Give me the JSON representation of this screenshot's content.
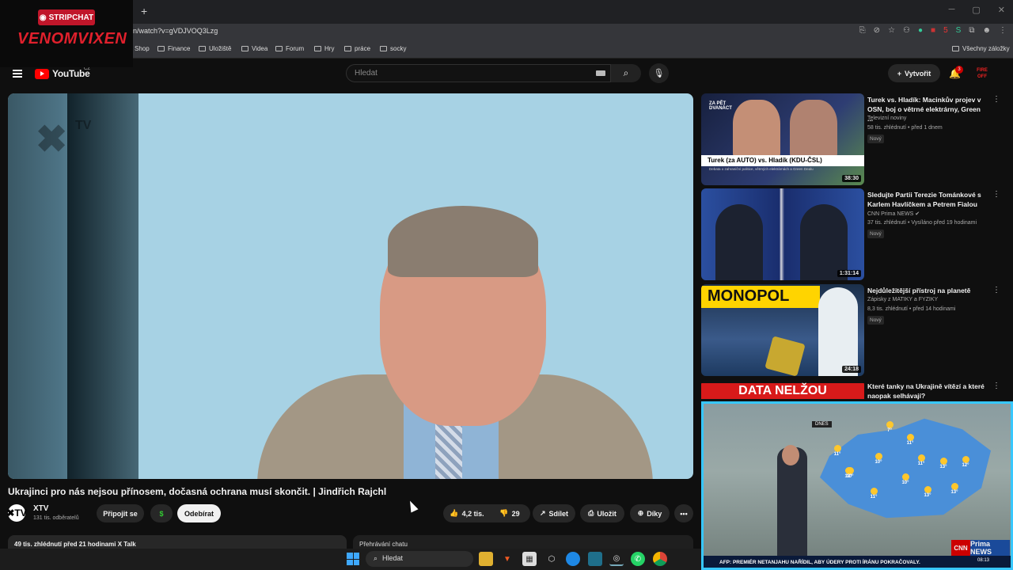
{
  "overlay": {
    "badge": "STRIPCHAT",
    "name": "VENOMVIXEN"
  },
  "browser": {
    "new_tab": "+",
    "url": "n/watch?v=gVDJVOQ3Lzg",
    "bookmarks": [
      "Shop",
      "Finance",
      "Uložiště",
      "Videa",
      "Forum",
      "Hry",
      "práce",
      "socky"
    ],
    "all_bookmarks": "Všechny záložky",
    "ext_badge": "5"
  },
  "youtube": {
    "logo": "YouTube",
    "region": "CZ",
    "search_placeholder": "Hledat",
    "create_label": "Vytvořit",
    "notif_count": "3",
    "avatar_text": "FIRE OFF"
  },
  "video": {
    "title": "Ukrajinci pro nás nejsou přínosem, dočasná ochrana musí skončit. | Jindřich Rajchl",
    "channel_logo": "✖TV",
    "watermark": "TV",
    "channel": "XTV",
    "subs": "131 tis. odběratelů",
    "join_label": "Připojit se",
    "dollar": "$",
    "subscribe_label": "Odebírat",
    "likes": "4,2 tis.",
    "dislikes": "29",
    "share_label": "Sdílet",
    "save_label": "Uložit",
    "thanks_label": "Díky",
    "more": "•••",
    "desc_line": "49 tis. zhlédnutí  před 21 hodinami  X Talk",
    "chat_replay": "Přehrávání chatu"
  },
  "recommendations": [
    {
      "title": "Turek vs. Hladík: Macinkův projev v OSN, boj o větrné elektrárny, Green ...",
      "channel": "Televizní noviny",
      "meta": "58 tis. zhlédnutí • před 1 dnem",
      "badge": "Nový",
      "duration": "38:30",
      "thumb_text": "Turek (za AUTO) vs. Hladík (KDU-ČSL)",
      "thumb_sub": "Debata o zahraniční politice, větrných elektrárnách a Green Dealu",
      "thumb_tag": "ZA PĚT\nDVANÁCT"
    },
    {
      "title": "Sledujte Partii Terezie Tománkové s Karlem Havlíčkem a Petrem Fialou",
      "channel": "CNN Prima NEWS ✔",
      "meta": "37 tis. zhlédnutí • Vysíláno před 19 hodinami",
      "badge": "Nový",
      "duration": "1:31:14"
    },
    {
      "title": "Nejdůležitější přístroj na planetě",
      "channel": "Zápisky z MATIKY a FYZIKY",
      "meta": "8,3 tis. zhlédnutí • před 14 hodinami",
      "badge": "Nový",
      "duration": "24:18",
      "thumb_text": "MONOPOL"
    },
    {
      "title": "Které tanky na Ukrajině vítězí a které naopak selhávají?",
      "thumb_text": "DATA NELŽOU"
    }
  ],
  "tv": {
    "today": "DNES",
    "ticker": "AFP: PREMIÉR NETANJAHU NAŘÍDIL, ABY ÚDERY PROTI ÍRÁNU POKRAČOVALY.",
    "time": "08:13",
    "cnn": "CNN",
    "prima": "Prima NEWS",
    "temps": [
      "11°",
      "10°",
      "7°",
      "11°",
      "10°",
      "11°",
      "13°",
      "12°",
      "12°",
      "10°",
      "11°",
      "13°",
      "13°"
    ]
  },
  "taskbar": {
    "search": "Hledat"
  }
}
